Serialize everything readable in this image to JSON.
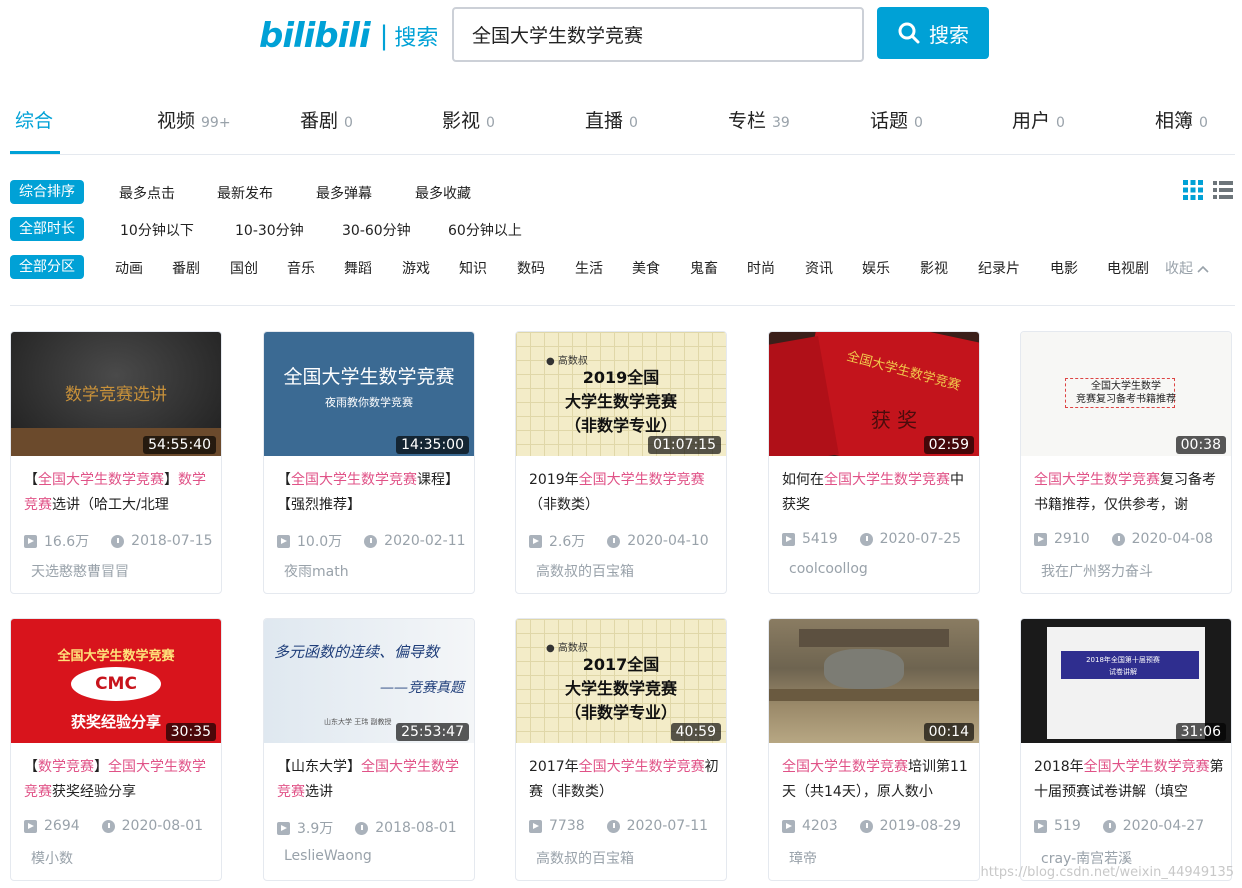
{
  "logo": {
    "brand": "bilibili",
    "sep": "|",
    "sub": "搜索"
  },
  "search": {
    "value": "全国大学生数学竞赛",
    "button_label": "搜索"
  },
  "tabs": [
    {
      "label": "综合",
      "count": ""
    },
    {
      "label": "视频",
      "count": "99+"
    },
    {
      "label": "番剧",
      "count": "0"
    },
    {
      "label": "影视",
      "count": "0"
    },
    {
      "label": "直播",
      "count": "0"
    },
    {
      "label": "专栏",
      "count": "39"
    },
    {
      "label": "话题",
      "count": "0"
    },
    {
      "label": "用户",
      "count": "0"
    },
    {
      "label": "相簿",
      "count": "0"
    }
  ],
  "filters": {
    "sort": {
      "active": "综合排序",
      "options": [
        "最多点击",
        "最新发布",
        "最多弹幕",
        "最多收藏"
      ]
    },
    "duration": {
      "active": "全部时长",
      "options": [
        "10分钟以下",
        "10-30分钟",
        "30-60分钟",
        "60分钟以上"
      ]
    },
    "zone": {
      "active": "全部分区",
      "options": [
        "动画",
        "番剧",
        "国创",
        "音乐",
        "舞蹈",
        "游戏",
        "知识",
        "数码",
        "生活",
        "美食",
        "鬼畜",
        "时尚",
        "资讯",
        "娱乐",
        "影视",
        "纪录片",
        "电影",
        "电视剧"
      ],
      "collapse": "收起"
    }
  },
  "accent_color": "#00a1d6",
  "highlight_color": "#e05287",
  "videos": [
    {
      "duration": "54:55:40",
      "title_parts": [
        [
          "【",
          0
        ],
        [
          "全国大学生数学竞赛",
          1
        ],
        [
          "】",
          0
        ],
        [
          "数学竞赛",
          1
        ],
        [
          "选讲（哈工大/北理",
          0
        ]
      ],
      "views": "16.6万",
      "date": "2018-07-15",
      "uploader": "天选憨憨曹冒冒",
      "thumb_text": "数学竞赛选讲"
    },
    {
      "duration": "14:35:00",
      "title_parts": [
        [
          "【",
          0
        ],
        [
          "全国大学生数学竞赛",
          1
        ],
        [
          "课程】【强烈推荐】",
          0
        ]
      ],
      "views": "10.0万",
      "date": "2020-02-11",
      "uploader": "夜雨math",
      "thumb_text": "全国大学生数学竞赛",
      "thumb_sub": "夜雨教你数学竞赛"
    },
    {
      "duration": "01:07:15",
      "title_parts": [
        [
          "2019年",
          0
        ],
        [
          "全国大学生数学竞赛",
          1
        ],
        [
          "（非数类）",
          0
        ]
      ],
      "views": "2.6万",
      "date": "2020-04-10",
      "uploader": "高数叔的百宝箱",
      "thumb_brand": "高数叔",
      "thumb_lines": [
        "2019全国",
        "大学生数学竞赛",
        "（非数学专业）"
      ]
    },
    {
      "duration": "02:59",
      "title_parts": [
        [
          "如何在",
          0
        ],
        [
          "全国大学生数学竞赛",
          1
        ],
        [
          "中获奖",
          0
        ]
      ],
      "views": "5419",
      "date": "2020-07-25",
      "uploader": "coolcoollog",
      "thumb_text": "全国大学生数学竞赛",
      "thumb_sub": "获 奖"
    },
    {
      "duration": "00:38",
      "title_parts": [
        [
          "全国大学生数学竞赛",
          1
        ],
        [
          "复习备考书籍推荐，仅供参考，谢",
          0
        ]
      ],
      "views": "2910",
      "date": "2020-04-08",
      "uploader": "我在广州努力奋斗",
      "thumb_lines": [
        "全国大学生数学",
        "竞赛复习备考书籍推荐"
      ]
    },
    {
      "duration": "30:35",
      "title_parts": [
        [
          "【",
          0
        ],
        [
          "数学竞赛",
          1
        ],
        [
          "】",
          0
        ],
        [
          "全国大学生数学竞赛",
          1
        ],
        [
          "获奖经验分享",
          0
        ]
      ],
      "views": "2694",
      "date": "2020-08-01",
      "uploader": "模小数",
      "thumb_text": "全国大学生数学竞赛",
      "thumb_sub": "获奖经验分享",
      "thumb_logo": "CMC"
    },
    {
      "duration": "25:53:47",
      "title_parts": [
        [
          "【山东大学】",
          0
        ],
        [
          "全国大学生数学竞赛",
          1
        ],
        [
          "选讲",
          0
        ]
      ],
      "views": "3.9万",
      "date": "2018-08-01",
      "uploader": "LeslieWaong",
      "thumb_lines": [
        "多元函数的连续、偏导数",
        "——竞赛真题"
      ],
      "thumb_caption": "山东大学 王玮 副教授"
    },
    {
      "duration": "40:59",
      "title_parts": [
        [
          "2017年",
          0
        ],
        [
          "全国大学生数学竞赛",
          1
        ],
        [
          "初赛（非数类）",
          0
        ]
      ],
      "views": "7738",
      "date": "2020-07-11",
      "uploader": "高数叔的百宝箱",
      "thumb_brand": "高数叔",
      "thumb_lines": [
        "2017全国",
        "大学生数学竞赛",
        "（非数学专业）"
      ]
    },
    {
      "duration": "00:14",
      "title_parts": [
        [
          "全国大学生数学竞赛",
          1
        ],
        [
          "培训第11天（共14天），原人数小",
          0
        ]
      ],
      "views": "4203",
      "date": "2019-08-29",
      "uploader": "璋帝"
    },
    {
      "duration": "31:06",
      "title_parts": [
        [
          "2018年",
          0
        ],
        [
          "全国大学生数学竞赛",
          1
        ],
        [
          "第十届预赛试卷讲解（填空",
          0
        ]
      ],
      "views": "519",
      "date": "2020-04-27",
      "uploader": "cray-南宫若溪",
      "thumb_lines": [
        "2018年全国第十届预赛",
        "试卷讲解"
      ]
    }
  ],
  "watermark": "https://blog.csdn.net/weixin_44949135"
}
